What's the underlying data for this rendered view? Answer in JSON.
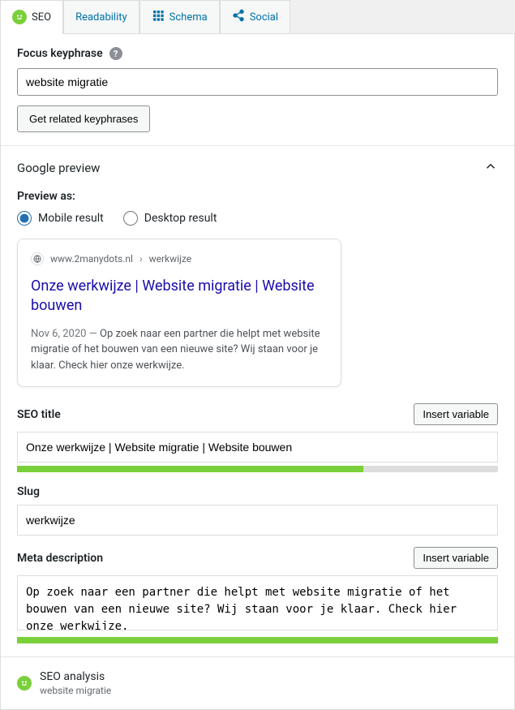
{
  "tabs": {
    "seo": "SEO",
    "readability": "Readability",
    "schema": "Schema",
    "social": "Social"
  },
  "focus": {
    "label": "Focus keyphrase",
    "value": "website migratie",
    "related_btn": "Get related keyphrases"
  },
  "google_preview": {
    "heading": "Google preview",
    "preview_as": "Preview as:",
    "mobile": "Mobile result",
    "desktop": "Desktop result",
    "domain": "www.2manydots.nl",
    "path": "werkwijze",
    "title": "Onze werkwijze | Website migratie | Website bouwen",
    "date": "Nov 6, 2020",
    "desc": "Op zoek naar een partner die helpt met website migratie of het bouwen van een nieuwe site? Wij staan voor je klaar. Check hier onze werkwijze."
  },
  "fields": {
    "seo_title_label": "SEO title",
    "seo_title_value": "Onze werkwijze | Website migratie | Website bouwen",
    "seo_title_progress_pct": 72,
    "slug_label": "Slug",
    "slug_value": "werkwijze",
    "meta_label": "Meta description",
    "meta_value": "Op zoek naar een partner die helpt met website migratie of het bouwen van een nieuwe site? Wij staan voor je klaar. Check hier onze werkwijze.",
    "meta_progress_pct": 100,
    "insert_variable": "Insert variable"
  },
  "analysis": {
    "title": "SEO analysis",
    "keyphrase": "website migratie"
  }
}
